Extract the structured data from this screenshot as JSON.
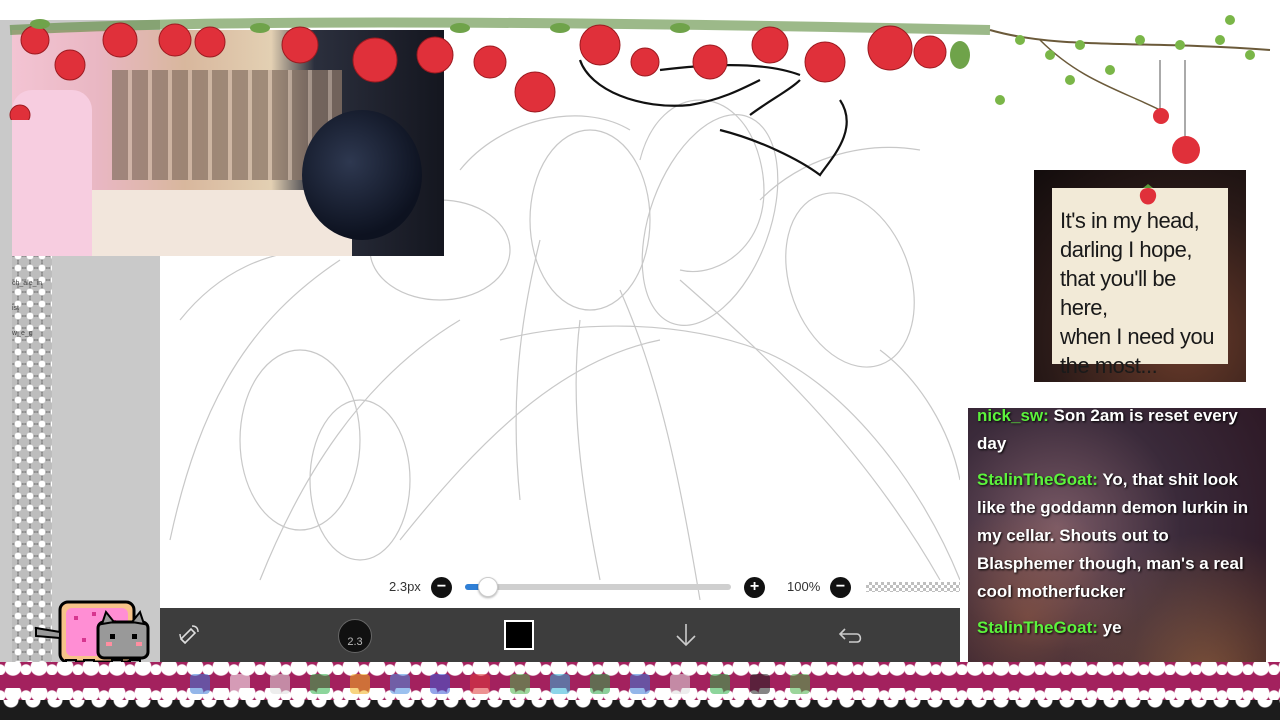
{
  "quote": {
    "lines": [
      "It's in my head,",
      "darling I hope,",
      "that you'll be here,",
      "when I need you",
      "the most..."
    ]
  },
  "chat": {
    "messages": [
      {
        "user": "nick_sw:",
        "text": " Son 2am is reset every day",
        "user_color": "#5cf23c"
      },
      {
        "user": "StalinTheGoat:",
        "text": " Yo, that shit look like the goddamn demon lurkin in my cellar. Shouts out to Blasphemer though, man's a real cool motherfucker",
        "user_color": "#5cf23c"
      },
      {
        "user": "StalinTheGoat:",
        "text": " ye",
        "user_color": "#5cf23c"
      }
    ]
  },
  "brush": {
    "size_label": "2.3px",
    "size_value": 2.3,
    "size_fraction": 0.05,
    "opacity_label": "100%",
    "minus_symbol": "−",
    "plus_symbol": "+"
  },
  "toolbar": {
    "brush_size_badge": "2.3",
    "current_color": "#000000",
    "tools": [
      "transform-icon",
      "brush-size-icon",
      "color-swatch",
      "download-arrow-icon",
      "undo-icon"
    ]
  },
  "left_panel": {
    "labels": [
      "ch_ale_in",
      "ist",
      "w_e_g"
    ]
  },
  "colors": {
    "accent_blue": "#2f7fd6",
    "toolbar_bg": "#3d3d3d",
    "lace_magenta": "#a3215e",
    "chat_username": "#5cf23c"
  }
}
